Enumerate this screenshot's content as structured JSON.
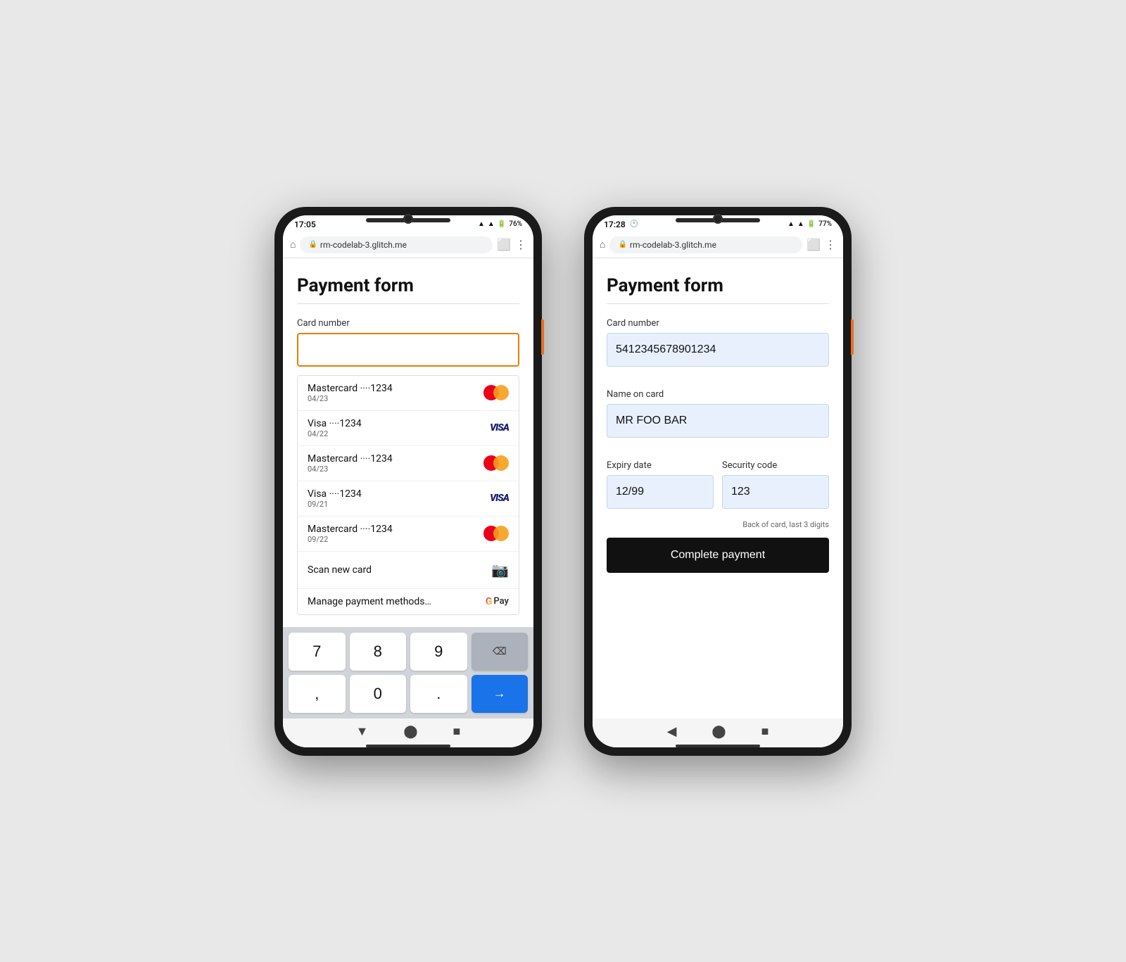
{
  "phone_left": {
    "status_bar": {
      "time": "17:05",
      "battery": "76%",
      "icons": "▲▲🔋"
    },
    "browser": {
      "url": "rm-codelab-3.glitch.me"
    },
    "page": {
      "title": "Payment form",
      "card_number_label": "Card number",
      "autocomplete_items": [
        {
          "name": "Mastercard ····1234",
          "expiry": "04/23",
          "type": "mastercard"
        },
        {
          "name": "Visa ····1234",
          "expiry": "04/22",
          "type": "visa"
        },
        {
          "name": "Mastercard ····1234",
          "expiry": "04/23",
          "type": "mastercard"
        },
        {
          "name": "Visa ····1234",
          "expiry": "09/21",
          "type": "visa"
        },
        {
          "name": "Mastercard ····1234",
          "expiry": "09/22",
          "type": "mastercard"
        }
      ],
      "scan_label": "Scan new card",
      "manage_label": "Manage payment methods…"
    },
    "keyboard": {
      "keys": [
        "7",
        "8",
        "9",
        "⌫",
        ",",
        "0",
        ".",
        "→"
      ]
    }
  },
  "phone_right": {
    "status_bar": {
      "time": "17:28",
      "battery": "77%"
    },
    "browser": {
      "url": "rm-codelab-3.glitch.me"
    },
    "page": {
      "title": "Payment form",
      "card_number_label": "Card number",
      "card_number_value": "5412345678901234",
      "name_label": "Name on card",
      "name_value": "MR FOO BAR",
      "expiry_label": "Expiry date",
      "expiry_value": "12/99",
      "security_label": "Security code",
      "security_value": "123",
      "security_hint": "Back of card, last 3 digits",
      "submit_label": "Complete payment"
    }
  }
}
